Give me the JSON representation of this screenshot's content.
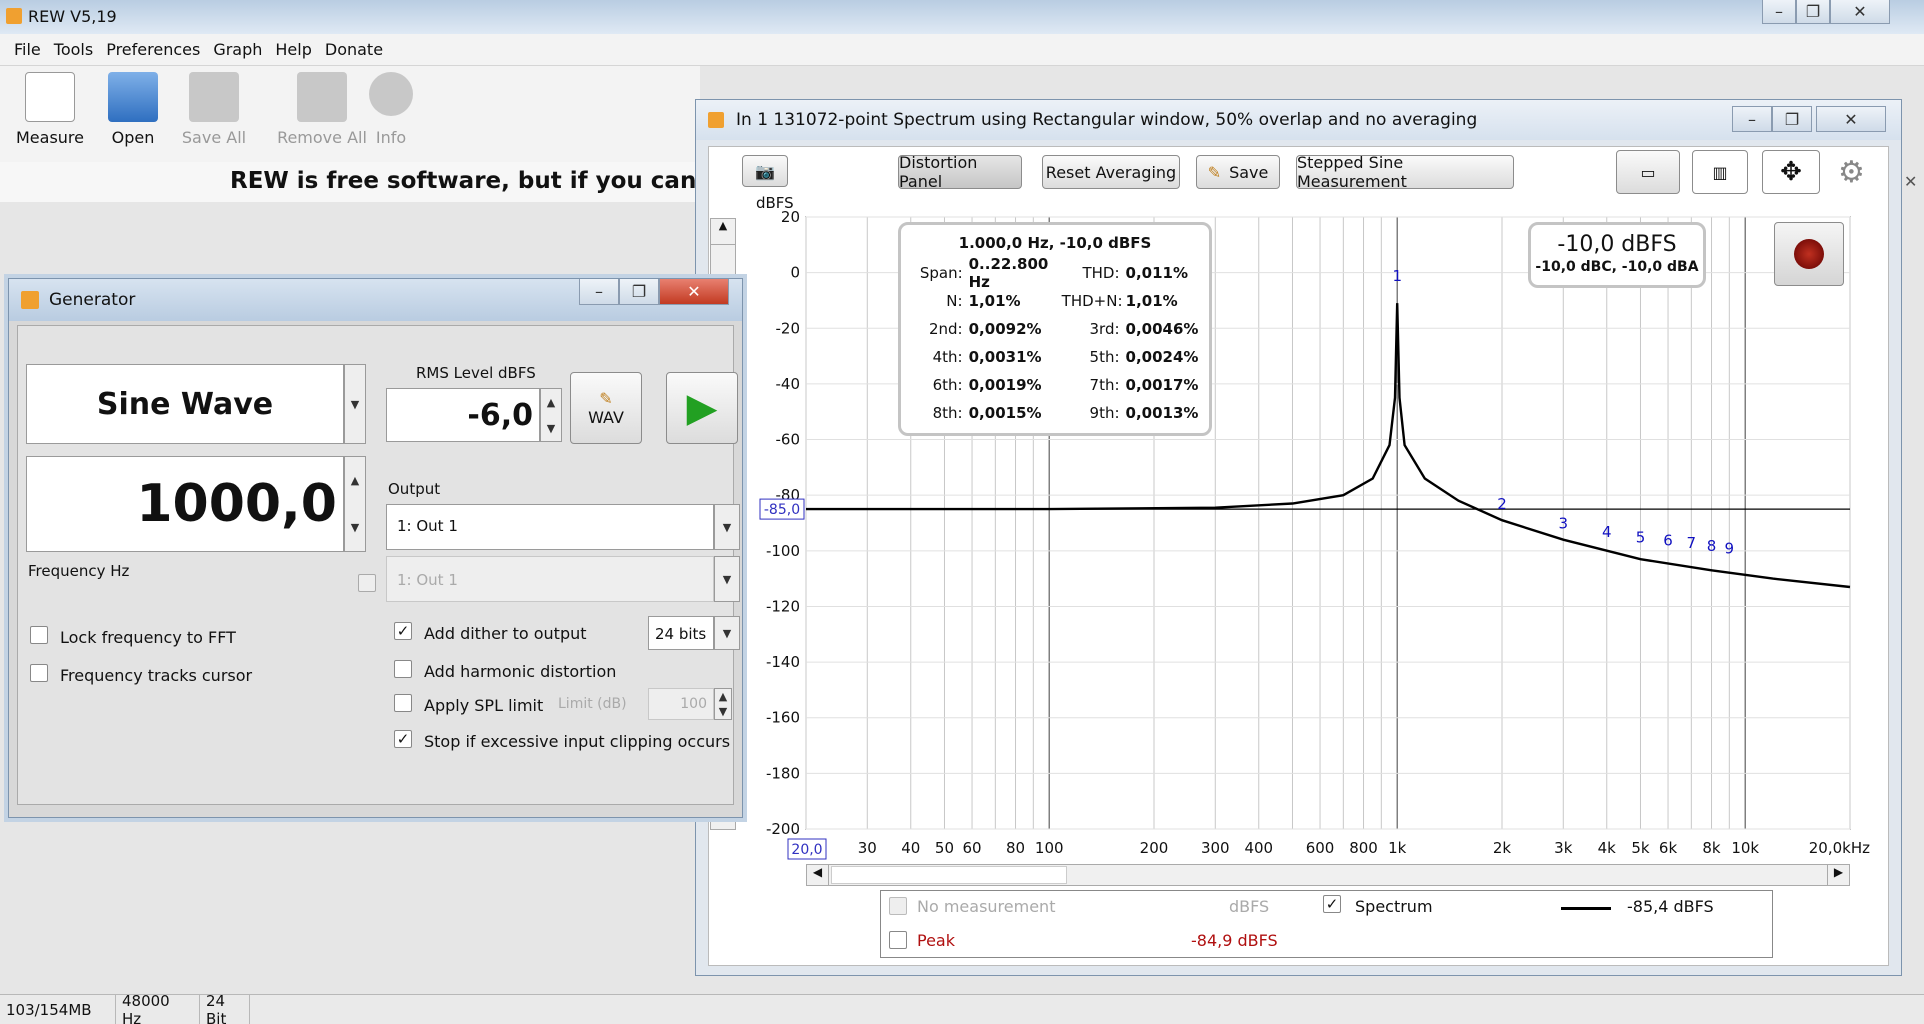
{
  "app": {
    "title": "REW V5,19"
  },
  "menu": [
    "File",
    "Tools",
    "Preferences",
    "Graph",
    "Help",
    "Donate"
  ],
  "toolbar": {
    "measure": "Measure",
    "open": "Open",
    "save_all": "Save All",
    "remove_all": "Remove All",
    "info": "Info"
  },
  "banner": "REW is free software, but if you can affor",
  "statusbar": {
    "memory": "103/154MB",
    "rate": "48000 Hz",
    "bits": "24 Bit"
  },
  "generator": {
    "title": "Generator",
    "signal": "Sine Wave",
    "rms_label": "RMS Level dBFS",
    "rms_value": "-6,0",
    "wav_label": "WAV",
    "frequency": "1000,0",
    "frequency_label": "Frequency Hz",
    "output_label": "Output",
    "output_value": "1: Out 1",
    "output2_value": "1: Out 1",
    "lock_fft": "Lock frequency to FFT",
    "tracks_cursor": "Frequency tracks cursor",
    "add_dither": "Add dither to output",
    "dither_bits": "24 bits",
    "add_harmonic": "Add harmonic distortion",
    "apply_spl": "Apply SPL limit",
    "limit_label": "Limit (dB)",
    "limit_value": "100",
    "stop_clipping": "Stop if excessive input clipping occurs"
  },
  "spectrum": {
    "title": "In 1 131072-point Spectrum using Rectangular window, 50% overlap and no averaging",
    "btn_distortion": "Distortion Panel",
    "btn_reset": "Reset Averaging",
    "btn_save": "Save",
    "btn_stepped": "Stepped Sine Measurement",
    "unit": "dBFS",
    "cursor_y": "-85,0",
    "cursor_x": "20,0",
    "level_main": "-10,0 dBFS",
    "level_sub": "-10,0 dBC, -10,0 dBA",
    "dist_header": "1.000,0 Hz, -10,0 dBFS",
    "dist_rows": [
      {
        "l1": "Span:",
        "v1": "0..22.800 Hz",
        "l2": "THD:",
        "v2": "0,011%"
      },
      {
        "l1": "N:",
        "v1": "1,01%",
        "l2": "THD+N:",
        "v2": "1,01%"
      },
      {
        "l1": "2nd:",
        "v1": "0,0092%",
        "l2": "3rd:",
        "v2": "0,0046%"
      },
      {
        "l1": "4th:",
        "v1": "0,0031%",
        "l2": "5th:",
        "v2": "0,0024%"
      },
      {
        "l1": "6th:",
        "v1": "0,0019%",
        "l2": "7th:",
        "v2": "0,0017%"
      },
      {
        "l1": "8th:",
        "v1": "0,0015%",
        "l2": "9th:",
        "v2": "0,0013%"
      }
    ],
    "legend": {
      "no_meas": "No measurement",
      "no_meas_unit": "dBFS",
      "spectrum": "Spectrum",
      "spectrum_val": "-85,4 dBFS",
      "peak": "Peak",
      "peak_val": "-84,9 dBFS"
    },
    "colors": {
      "trace": "#000000",
      "harmonic": "#1010c0",
      "peak": "#c00000"
    }
  },
  "chart_data": {
    "type": "line",
    "xscale": "log",
    "xlim": [
      20,
      20000
    ],
    "ylim": [
      -200,
      20
    ],
    "yticks": [
      20,
      0,
      -20,
      -40,
      -60,
      -80,
      -100,
      -120,
      -140,
      -160,
      -180,
      -200
    ],
    "xticks": [
      {
        "v": 30,
        "t": "30"
      },
      {
        "v": 40,
        "t": "40"
      },
      {
        "v": 50,
        "t": "50"
      },
      {
        "v": 60,
        "t": "60"
      },
      {
        "v": 80,
        "t": "80"
      },
      {
        "v": 100,
        "t": "100"
      },
      {
        "v": 200,
        "t": "200"
      },
      {
        "v": 300,
        "t": "300"
      },
      {
        "v": 400,
        "t": "400"
      },
      {
        "v": 600,
        "t": "600"
      },
      {
        "v": 800,
        "t": "800"
      },
      {
        "v": 1000,
        "t": "1k"
      },
      {
        "v": 2000,
        "t": "2k"
      },
      {
        "v": 3000,
        "t": "3k"
      },
      {
        "v": 4000,
        "t": "4k"
      },
      {
        "v": 5000,
        "t": "5k"
      },
      {
        "v": 6000,
        "t": "6k"
      },
      {
        "v": 8000,
        "t": "8k"
      },
      {
        "v": 10000,
        "t": "10k"
      },
      {
        "v": 20000,
        "t": "20,0kHz"
      }
    ],
    "series": [
      {
        "name": "Spectrum",
        "x": [
          20,
          100,
          300,
          500,
          700,
          850,
          950,
          985,
          1000,
          1015,
          1050,
          1200,
          1500,
          2000,
          3000,
          5000,
          8000,
          12000,
          20000
        ],
        "y": [
          -85,
          -85,
          -84.5,
          -83,
          -80,
          -74,
          -62,
          -45,
          -11,
          -45,
          -62,
          -74,
          -82,
          -89,
          -96,
          -103,
          -107,
          -110,
          -113
        ]
      }
    ],
    "harmonics": [
      {
        "n": "1",
        "x": 1000,
        "y": -3
      },
      {
        "n": "2",
        "x": 2000,
        "y": -85
      },
      {
        "n": "3",
        "x": 3000,
        "y": -92
      },
      {
        "n": "4",
        "x": 4000,
        "y": -95
      },
      {
        "n": "5",
        "x": 5000,
        "y": -97
      },
      {
        "n": "6",
        "x": 6000,
        "y": -98
      },
      {
        "n": "7",
        "x": 7000,
        "y": -99
      },
      {
        "n": "8",
        "x": 8000,
        "y": -100
      },
      {
        "n": "9",
        "x": 9000,
        "y": -101
      }
    ],
    "cursor": {
      "y": -85
    }
  }
}
